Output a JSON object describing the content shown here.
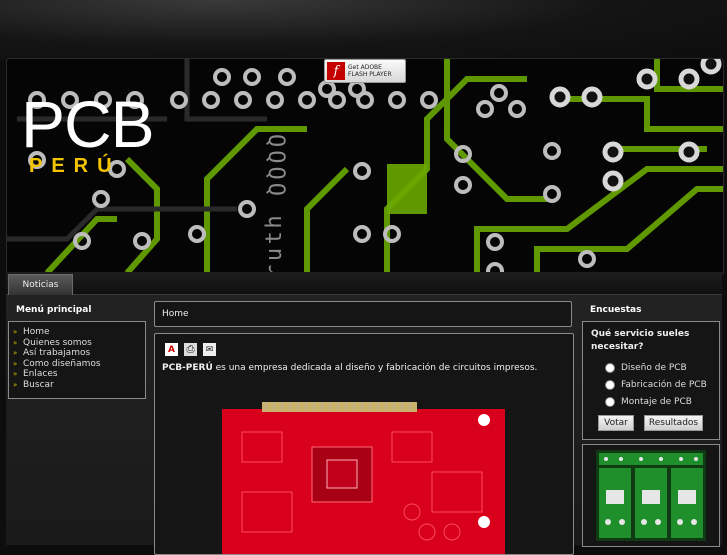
{
  "header": {
    "logo_main": "PCB",
    "logo_sub": "PERÚ",
    "flash_badge": {
      "line1": "Get ADOBE",
      "line2": "FLASH PLAYER"
    }
  },
  "nav": {
    "tabs": [
      {
        "label": "Noticias"
      }
    ]
  },
  "left": {
    "title": "Menú principal",
    "items": [
      {
        "label": "Home"
      },
      {
        "label": "Quienes somos"
      },
      {
        "label": "Así trabajamos"
      },
      {
        "label": "Como diseñamos"
      },
      {
        "label": "Enlaces"
      },
      {
        "label": "Buscar"
      }
    ]
  },
  "center": {
    "breadcrumb": "Home",
    "article": {
      "brand": "PCB-PERÚ",
      "text": " es una empresa dedicada al diseño y fabricación de circuitos impresos."
    }
  },
  "right": {
    "title": "Encuestas",
    "poll": {
      "question": "Qué servicio sueles necesitar?",
      "options": [
        {
          "label": "Diseño de PCB"
        },
        {
          "label": "Fabricación de PCB"
        },
        {
          "label": "Montaje de PCB"
        }
      ],
      "vote_label": "Votar",
      "results_label": "Resultados"
    }
  },
  "colors": {
    "trace_green": "#8ed400",
    "logo_yellow": "#f5c400",
    "pcb_red": "#e0001a",
    "thumb_green": "#1f8f2c"
  }
}
